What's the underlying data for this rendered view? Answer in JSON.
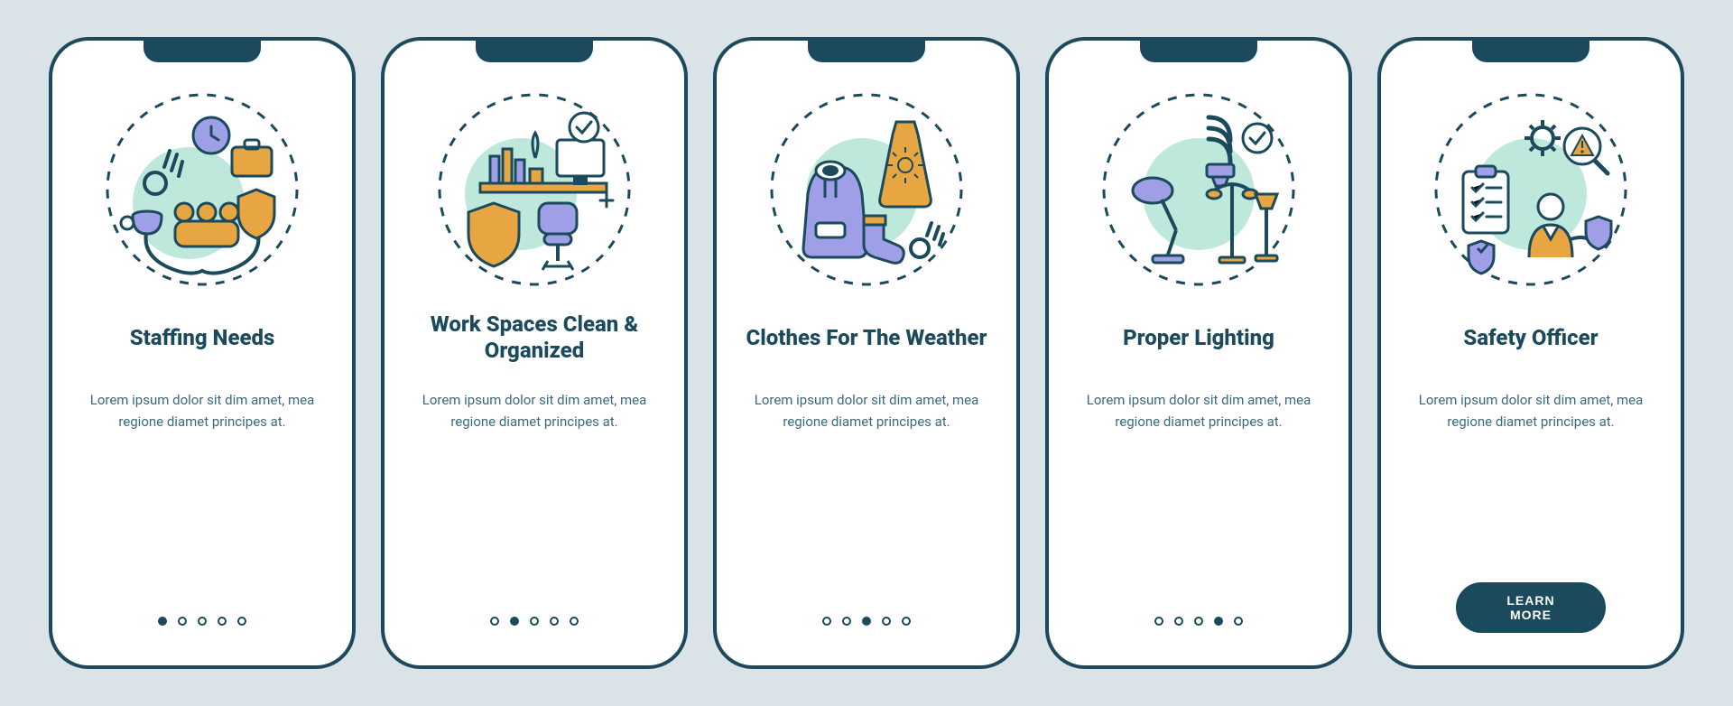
{
  "colors": {
    "stroke": "#1a4a5c",
    "mint": "#bfe8dd",
    "orange": "#e8a642",
    "purple": "#9f9fe8",
    "page_bg": "#d9e3e8",
    "card_bg": "#ffffff"
  },
  "screens": [
    {
      "icon": "staffing-needs-icon",
      "title": "Staffing Needs",
      "desc": "Lorem ipsum dolor sit dim amet, mea regione diamet principes at.",
      "active_dot": 0
    },
    {
      "icon": "work-spaces-icon",
      "title": "Work Spaces Clean & Organized",
      "desc": "Lorem ipsum dolor sit dim amet, mea regione diamet principes at.",
      "active_dot": 1
    },
    {
      "icon": "clothes-weather-icon",
      "title": "Clothes For The Weather",
      "desc": "Lorem ipsum dolor sit dim amet, mea regione diamet principes at.",
      "active_dot": 2
    },
    {
      "icon": "proper-lighting-icon",
      "title": "Proper Lighting",
      "desc": "Lorem ipsum dolor sit dim amet, mea regione diamet principes at.",
      "active_dot": 3
    },
    {
      "icon": "safety-officer-icon",
      "title": "Safety Officer",
      "desc": "Lorem ipsum dolor sit dim amet, mea regione diamet principes at.",
      "cta": "LEARN MORE"
    }
  ],
  "dot_count": 5
}
